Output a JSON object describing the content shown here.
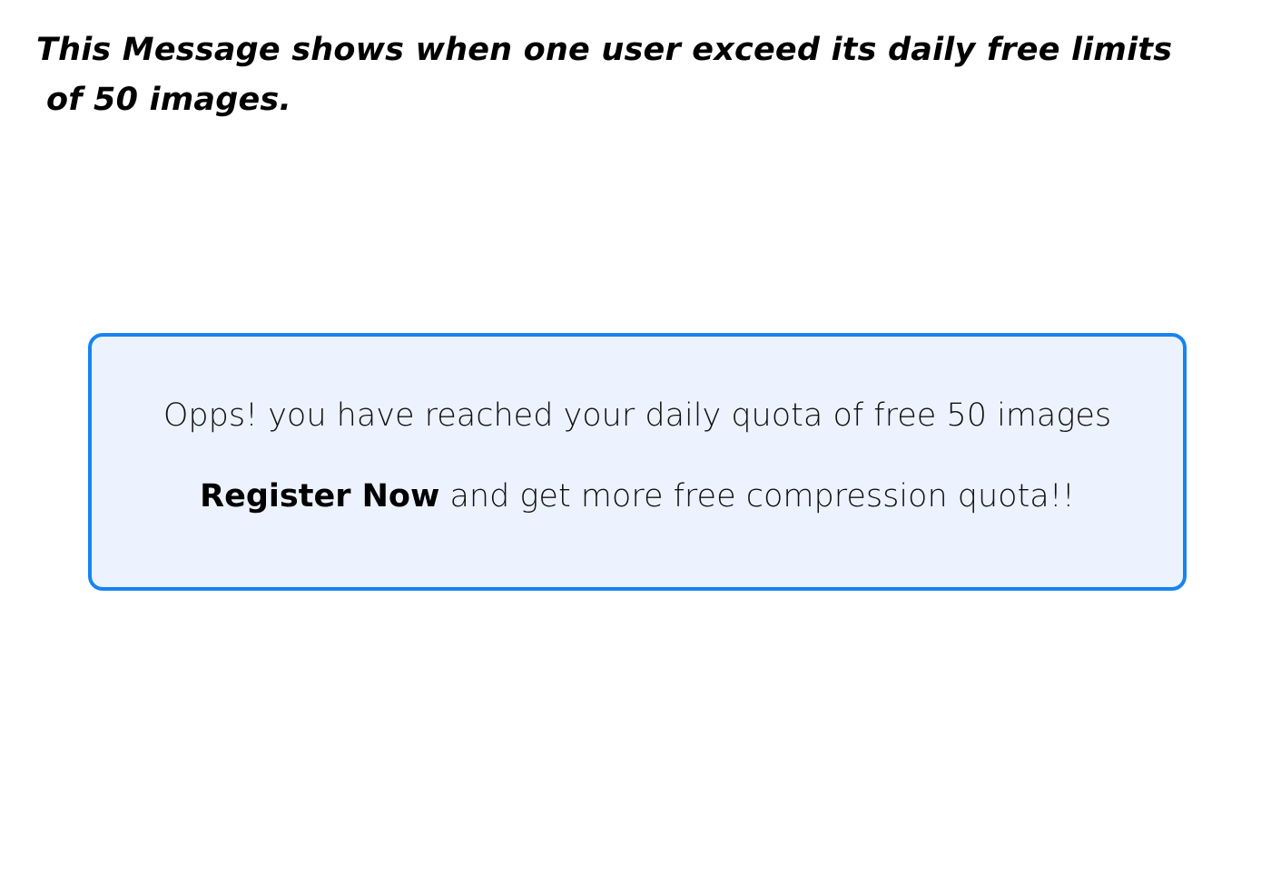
{
  "heading": {
    "line1": "This Message shows when one user exceed its daily free limits",
    "line2": "of 50 images."
  },
  "quota_message": {
    "text": "Opps! you have reached your daily quota of free 50 images",
    "register_label": "Register Now",
    "register_suffix": " and get more free compression quota!!"
  },
  "colors": {
    "box_border": "#1784f0",
    "box_background": "#ecf3fe",
    "text": "#000000"
  }
}
